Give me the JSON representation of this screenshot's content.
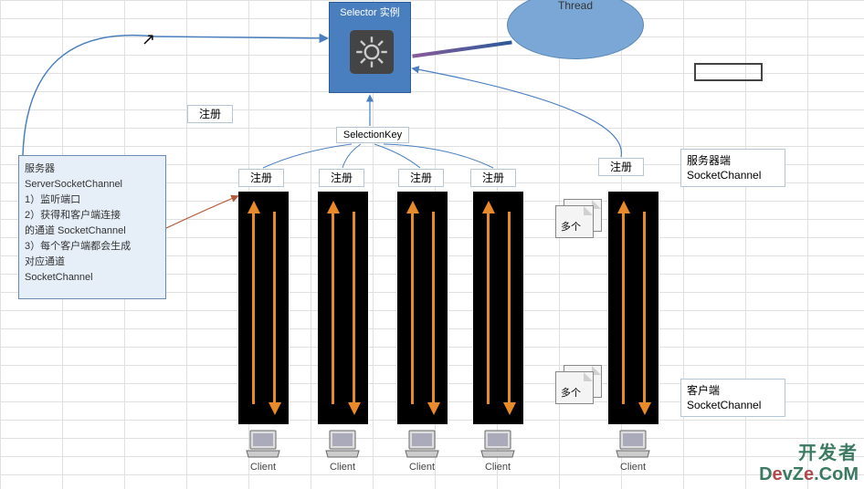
{
  "selector": {
    "title": "Selector 实例"
  },
  "thread": {
    "label": "Thread"
  },
  "selectionKey": {
    "label": "SelectionKey"
  },
  "registerLabels": {
    "top": "注册",
    "r1": "注册",
    "r2": "注册",
    "r3": "注册",
    "r4": "注册",
    "r5": "注册"
  },
  "serverBox": {
    "line1": "服务器",
    "line2": "ServerSocketChannel",
    "line3": "1）监听端口",
    "line4": "2）获得和客户端连接",
    "line5": "的通道 SocketChannel",
    "line6": "3）每个客户端都会生成",
    "line7": "对应通道",
    "line8": "SocketChannel"
  },
  "captions": {
    "serverSide": {
      "l1": "服务器端",
      "l2": "SocketChannel"
    },
    "clientSide": {
      "l1": "客户端",
      "l2": "SocketChannel"
    }
  },
  "multi": {
    "label1": "多个",
    "label2": "多个"
  },
  "clients": {
    "c1": "Client",
    "c2": "Client",
    "c3": "Client",
    "c4": "Client",
    "c5": "Client"
  },
  "watermark": {
    "line1": "开发者",
    "line2a": "D",
    "line2b": "e",
    "line2c": "vZ",
    "line2d": "e",
    "line2e": ".CoM"
  }
}
